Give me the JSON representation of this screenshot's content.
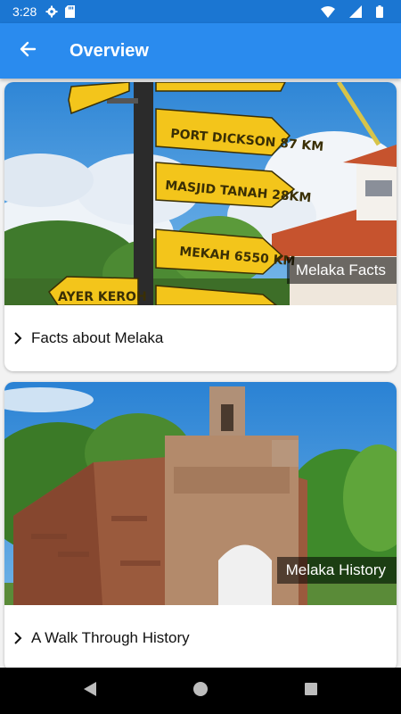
{
  "status_bar": {
    "time": "3:28",
    "icons": [
      "gear-icon",
      "sd-card-icon",
      "wifi-icon",
      "signal-icon",
      "battery-icon"
    ]
  },
  "app_bar": {
    "back_icon": "arrow-left-icon",
    "title": "Overview"
  },
  "cards": [
    {
      "caption": "Melaka Facts",
      "title": "Facts about Melaka",
      "chevron_icon": "chevron-right-icon"
    },
    {
      "caption": "Melaka History",
      "title": "A Walk Through History",
      "chevron_icon": "chevron-right-icon"
    }
  ],
  "nav_bar": {
    "icons": [
      "back-triangle-icon",
      "home-circle-icon",
      "recents-square-icon"
    ]
  },
  "colors": {
    "status_bar": "#1b76d2",
    "app_bar": "#2a8bee",
    "sign_yellow": "#f3c51b"
  }
}
